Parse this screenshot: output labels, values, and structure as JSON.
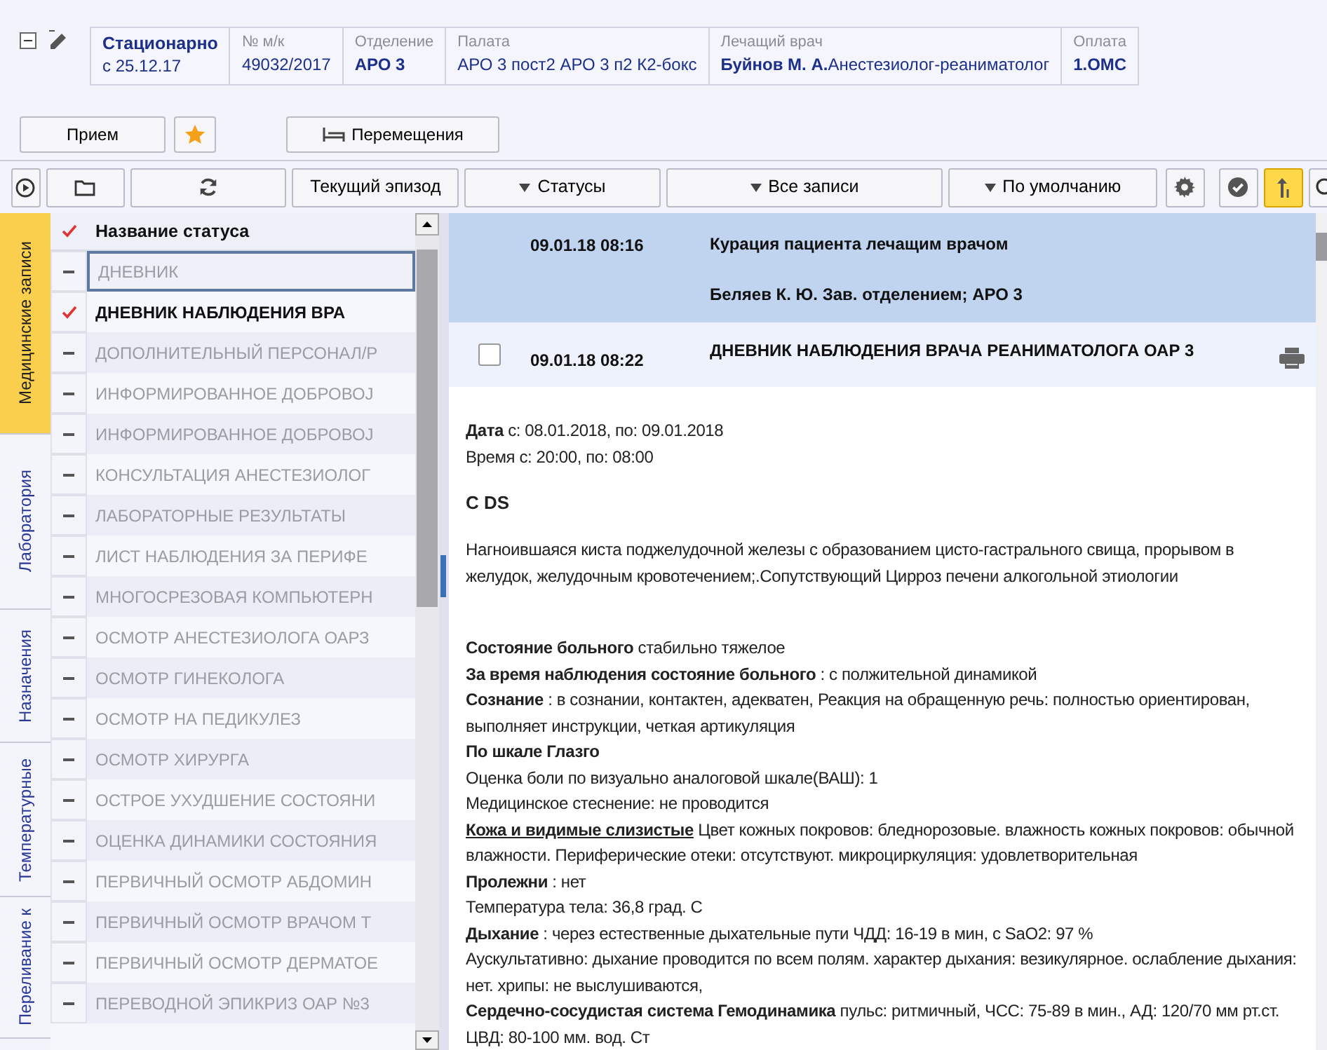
{
  "patient_bar": {
    "cells": [
      {
        "title": "Стационарно",
        "value": "с 25.12.17"
      },
      {
        "label": "№ м/к",
        "value": "49032/2017"
      },
      {
        "label": "Отделение",
        "value": "**АРО 3**"
      },
      {
        "label": "Палата",
        "value": "АРО 3 пост2 АРО 3 п2 К2-бокс"
      },
      {
        "label": "Лечащий врач",
        "value": "**Буйнов М. А.**Анестезиолог-реаниматолог"
      },
      {
        "label": "Оплата",
        "value": "**1.ОМС**"
      }
    ]
  },
  "action_buttons": [
    {
      "kind": "text",
      "label": "Прием"
    },
    {
      "kind": "favorite"
    },
    {
      "kind": "bed",
      "label": "Перемещения"
    }
  ],
  "toolbar": {
    "buttons": [
      {
        "kind": "text",
        "label": "Текущий эпизод"
      },
      {
        "kind": "dropdown",
        "label": "Статусы"
      },
      {
        "kind": "dropdown",
        "label": "Все записи"
      },
      {
        "kind": "dropdown",
        "label": "По умолчанию"
      }
    ],
    "sort_active": true
  },
  "side_tabs": [
    {
      "label": "Медицинские записи",
      "selected": true
    },
    {
      "label": "Лаборатория",
      "selected": false
    },
    {
      "label": "Назначения",
      "selected": false
    },
    {
      "label": "Температурные",
      "selected": false
    },
    {
      "label": "Переливание к",
      "selected": false
    }
  ],
  "status_list": {
    "header": "Название статуса",
    "items": [
      {
        "name": "ДНЕВНИК",
        "checked": false,
        "selected": true
      },
      {
        "name": "ДНЕВНИК НАБЛЮДЕНИЯ ВРА",
        "checked": true,
        "selected": false
      },
      {
        "name": "ДОПОЛНИТЕЛЬНЫЙ ПЕРСОНАЛ/Р",
        "checked": false,
        "selected": false
      },
      {
        "name": "ИНФОРМИРОВАННОЕ ДОБРОВОЈ",
        "checked": false,
        "selected": false
      },
      {
        "name": "ИНФОРМИРОВАННОЕ ДОБРОВОЈ",
        "checked": false,
        "selected": false
      },
      {
        "name": "КОНСУЛЬТАЦИЯ АНЕСТЕЗИОЛОГ",
        "checked": false,
        "selected": false
      },
      {
        "name": "ЛАБОРАТОРНЫЕ РЕЗУЛЬТАТЫ",
        "checked": false,
        "selected": false
      },
      {
        "name": "ЛИСТ НАБЛЮДЕНИЯ ЗА ПЕРИФЕ",
        "checked": false,
        "selected": false
      },
      {
        "name": "МНОГОСРЕЗОВАЯ КОМПЬЮТЕРН",
        "checked": false,
        "selected": false
      },
      {
        "name": "ОСМОТР АНЕСТЕЗИОЛОГА ОАРЗ",
        "checked": false,
        "selected": false
      },
      {
        "name": "ОСМОТР ГИНЕКОЛОГА",
        "checked": false,
        "selected": false
      },
      {
        "name": "ОСМОТР НА ПЕДИКУЛЕЗ",
        "checked": false,
        "selected": false
      },
      {
        "name": "ОСМОТР ХИРУРГА",
        "checked": false,
        "selected": false
      },
      {
        "name": "ОСТРОЕ УХУДШЕНИЕ СОСТОЯНИ",
        "checked": false,
        "selected": false
      },
      {
        "name": "ОЦЕНКА ДИНАМИКИ СОСТОЯНИЯ",
        "checked": false,
        "selected": false
      },
      {
        "name": "ПЕРВИЧНЫЙ ОСМОТР АБДОМИН",
        "checked": false,
        "selected": false
      },
      {
        "name": "ПЕРВИЧНЫЙ ОСМОТР ВРАЧОМ Т",
        "checked": false,
        "selected": false
      },
      {
        "name": "ПЕРВИЧНЫЙ ОСМОТР ДЕРМАТОЕ",
        "checked": false,
        "selected": false
      },
      {
        "name": "ПЕРЕВОДНОЙ ЭПИКРИЗ ОАР №3",
        "checked": false,
        "selected": false
      }
    ]
  },
  "entries": [
    {
      "kind": "note",
      "date": "09.01.18 08:16",
      "title": "Курация пациента лечащим врачом",
      "author": "Беляев К. Ю. Зав. отделением; АРО 3",
      "selected": true
    },
    {
      "kind": "document",
      "date": "09.01.18 08:22",
      "title": "ДНЕВНИК НАБЛЮДЕНИЯ ВРАЧА РЕАНИМАТОЛОГА ОАР 3",
      "selected": false,
      "checked": false
    }
  ],
  "document_body": [
    [
      {
        "label": "Дата",
        "text": "с: 08.01.2018, по: 09.01.2018"
      },
      {
        "text": "Время с: 20:00, по: 08:00"
      }
    ],
    [
      {
        "kind": "heading",
        "text": "С DS"
      }
    ],
    [
      {
        "text": "Нагноившаяся киста поджелудочной железы с образованием цисто-гастрального свища, прорывом в желудок, желудочным кровотечением;.Сопутствующий Цирроз печени алкогольной этиологии"
      }
    ],
    [
      {
        "label": "Состояние больного",
        "text": "стабильно тяжелое"
      },
      {
        "label": "За время наблюдения состояние больного",
        "text": ": с полжительной динамикой"
      },
      {
        "label": "Сознание",
        "text": ": в сознании, контактен, адекватен, Реакция на обращенную речь: полностью ориентирован, выполняет инструкции, четкая артикуляция"
      },
      {
        "label": "По шкале Глазго"
      },
      {
        "text": "Оценка боли по визуально аналоговой шкале(ВАШ): 1"
      },
      {
        "text": "Медицинское стеснение: не проводится"
      },
      {
        "label": "Кожа и видимые слизистые",
        "underline": true,
        "text": "Цвет кожных покровов: бледнорозовые. влажность кожных покровов: обычной влажности. Периферические отеки: отсутствуют. микроциркуляция: удовлетворительная"
      },
      {
        "label": "Пролежни",
        "text": ": нет"
      },
      {
        "text": "Температура тела: 36,8 град. С"
      },
      {
        "label": "Дыхание",
        "text": ": через естественные дыхательные пути ЧДД: 16-19 в мин, с SaO2: 97 %"
      },
      {
        "text": "Аускультативно: дыхание проводится по всем полям. характер дыхания: везикулярное. ослабление дыхания: нет. хрипы: не выслушиваются,"
      },
      {
        "label": "Сердечно-сосудистая система Гемодинамика",
        "text": "пульс: ритмичный, ЧСС: 75-89 в мин., АД: 120/70 мм рт.ст. ЦВД: 80-100 мм. вод. Ст"
      }
    ]
  ]
}
